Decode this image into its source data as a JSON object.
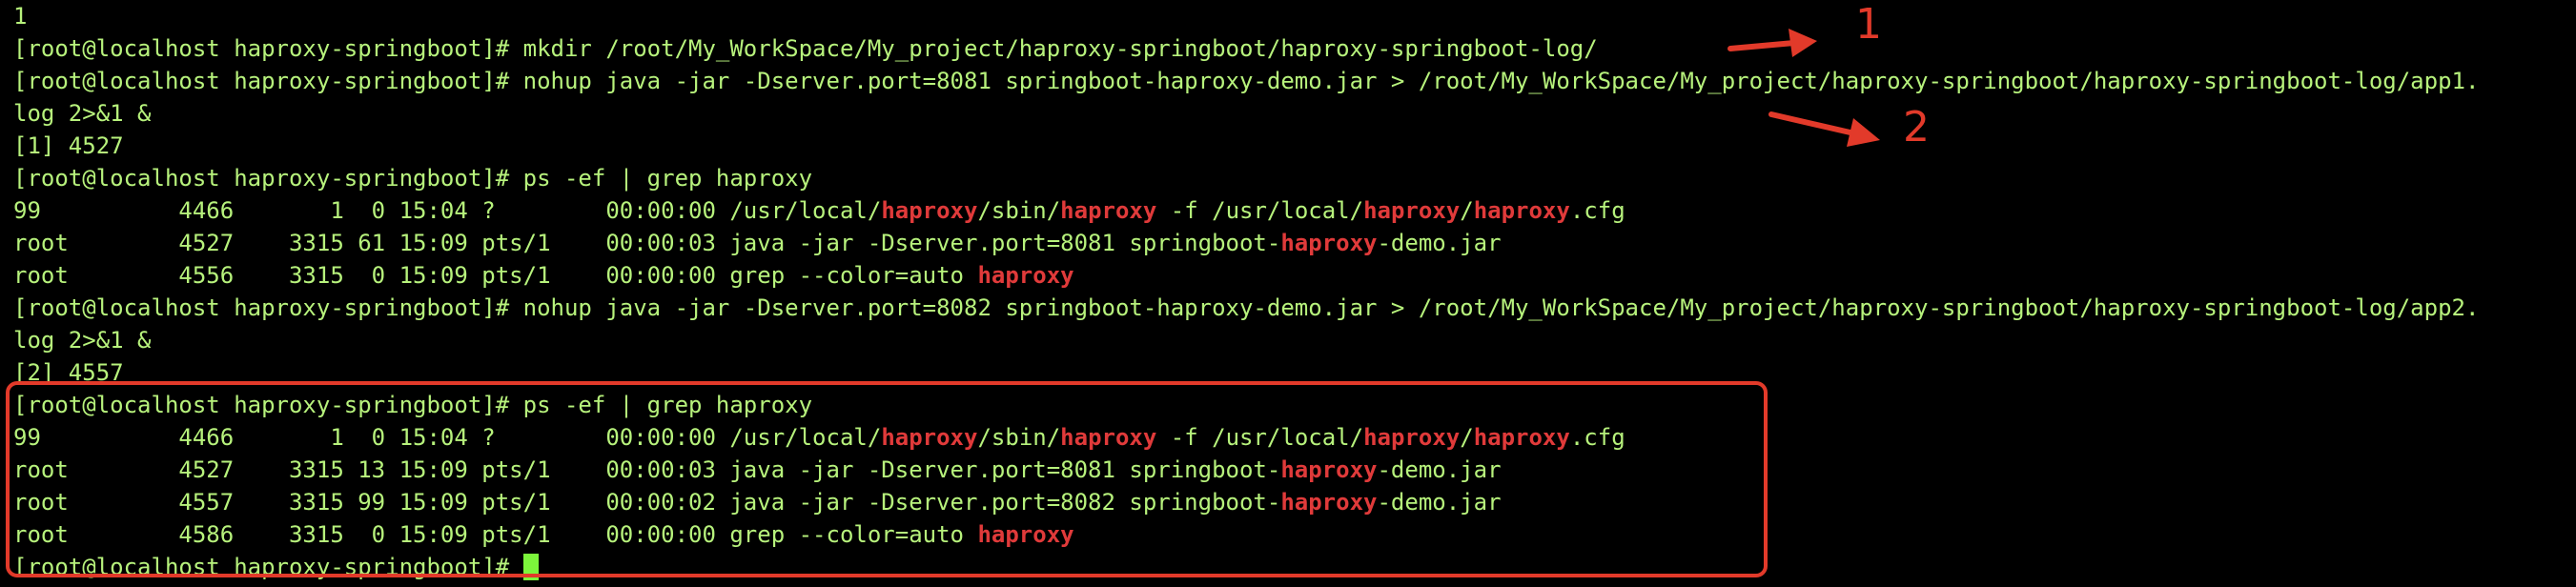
{
  "terminal": {
    "lines": [
      {
        "id": "l0",
        "segments": [
          {
            "t": "1",
            "h": false
          }
        ]
      },
      {
        "id": "l1",
        "segments": [
          {
            "t": "[root@localhost haproxy-springboot]# mkdir /root/My_WorkSpace/My_project/haproxy-springboot/haproxy-springboot-log/",
            "h": false
          }
        ]
      },
      {
        "id": "l2",
        "segments": [
          {
            "t": "[root@localhost haproxy-springboot]# nohup java -jar -Dserver.port=8081 springboot-haproxy-demo.jar > /root/My_WorkSpace/My_project/haproxy-springboot/haproxy-springboot-log/app1.",
            "h": false
          }
        ]
      },
      {
        "id": "l3",
        "segments": [
          {
            "t": "log 2>&1 &",
            "h": false
          }
        ]
      },
      {
        "id": "l4",
        "segments": [
          {
            "t": "[1] 4527",
            "h": false
          }
        ]
      },
      {
        "id": "l5",
        "segments": [
          {
            "t": "[root@localhost haproxy-springboot]# ps -ef | grep haproxy",
            "h": false
          }
        ]
      },
      {
        "id": "l6",
        "segments": [
          {
            "t": "99          4466       1  0 15:04 ?        00:00:00 /usr/local/",
            "h": false
          },
          {
            "t": "haproxy",
            "h": true
          },
          {
            "t": "/sbin/",
            "h": false
          },
          {
            "t": "haproxy",
            "h": true
          },
          {
            "t": " -f /usr/local/",
            "h": false
          },
          {
            "t": "haproxy",
            "h": true
          },
          {
            "t": "/",
            "h": false
          },
          {
            "t": "haproxy",
            "h": true
          },
          {
            "t": ".cfg",
            "h": false
          }
        ]
      },
      {
        "id": "l7",
        "segments": [
          {
            "t": "root        4527    3315 61 15:09 pts/1    00:00:03 java -jar -Dserver.port=8081 springboot-",
            "h": false
          },
          {
            "t": "haproxy",
            "h": true
          },
          {
            "t": "-demo.jar",
            "h": false
          }
        ]
      },
      {
        "id": "l8",
        "segments": [
          {
            "t": "root        4556    3315  0 15:09 pts/1    00:00:00 grep --color=auto ",
            "h": false
          },
          {
            "t": "haproxy",
            "h": true
          }
        ]
      },
      {
        "id": "l9",
        "segments": [
          {
            "t": "[root@localhost haproxy-springboot]# nohup java -jar -Dserver.port=8082 springboot-haproxy-demo.jar > /root/My_WorkSpace/My_project/haproxy-springboot/haproxy-springboot-log/app2.",
            "h": false
          }
        ]
      },
      {
        "id": "l10",
        "segments": [
          {
            "t": "log 2>&1 &",
            "h": false
          }
        ]
      },
      {
        "id": "l11",
        "segments": [
          {
            "t": "[2] 4557",
            "h": false
          }
        ]
      },
      {
        "id": "l12",
        "segments": [
          {
            "t": "[root@localhost haproxy-springboot]# ps -ef | grep haproxy",
            "h": false
          }
        ]
      },
      {
        "id": "l13",
        "segments": [
          {
            "t": "99          4466       1  0 15:04 ?        00:00:00 /usr/local/",
            "h": false
          },
          {
            "t": "haproxy",
            "h": true
          },
          {
            "t": "/sbin/",
            "h": false
          },
          {
            "t": "haproxy",
            "h": true
          },
          {
            "t": " -f /usr/local/",
            "h": false
          },
          {
            "t": "haproxy",
            "h": true
          },
          {
            "t": "/",
            "h": false
          },
          {
            "t": "haproxy",
            "h": true
          },
          {
            "t": ".cfg",
            "h": false
          }
        ]
      },
      {
        "id": "l14",
        "segments": [
          {
            "t": "root        4527    3315 13 15:09 pts/1    00:00:03 java -jar -Dserver.port=8081 springboot-",
            "h": false
          },
          {
            "t": "haproxy",
            "h": true
          },
          {
            "t": "-demo.jar",
            "h": false
          }
        ]
      },
      {
        "id": "l15",
        "segments": [
          {
            "t": "root        4557    3315 99 15:09 pts/1    00:00:02 java -jar -Dserver.port=8082 springboot-",
            "h": false
          },
          {
            "t": "haproxy",
            "h": true
          },
          {
            "t": "-demo.jar",
            "h": false
          }
        ]
      },
      {
        "id": "l16",
        "segments": [
          {
            "t": "root        4586    3315  0 15:09 pts/1    00:00:00 grep --color=auto ",
            "h": false
          },
          {
            "t": "haproxy",
            "h": true
          }
        ]
      },
      {
        "id": "l17",
        "segments": [
          {
            "t": "[root@localhost haproxy-springboot]# ",
            "h": false
          }
        ],
        "cursor": true
      }
    ]
  },
  "annotations": {
    "label_1": "1",
    "label_2": "2",
    "color": "#e23a2a"
  },
  "colors": {
    "background": "#000000",
    "text": "#b7f27c",
    "highlight": "#e03a3a",
    "cursor": "#7cf53b"
  }
}
